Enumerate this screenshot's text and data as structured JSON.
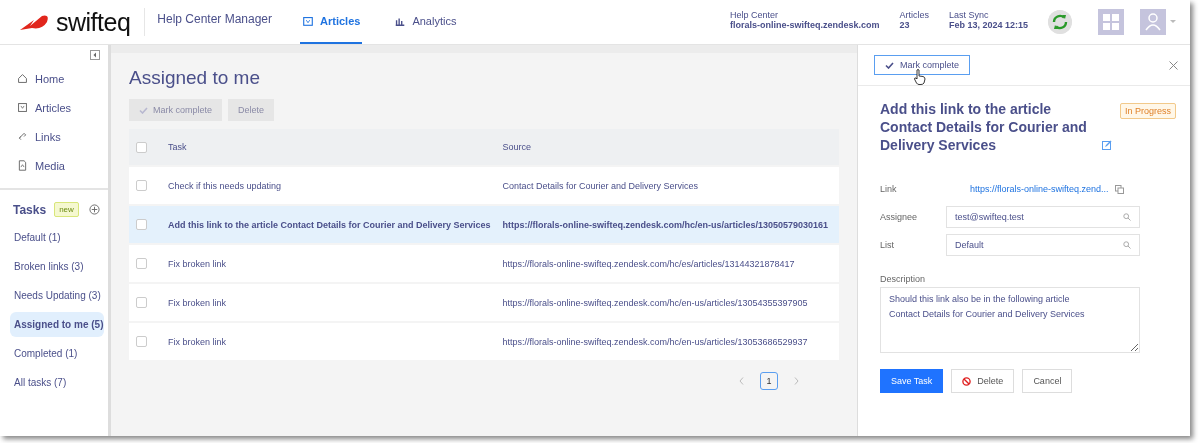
{
  "header": {
    "brand": "swifteq",
    "app_title": "Help Center Manager",
    "tabs": [
      {
        "label": "Articles",
        "selected": true,
        "kind": "articles"
      },
      {
        "label": "Analytics",
        "selected": false,
        "kind": "analytics"
      }
    ],
    "info": [
      {
        "label": "Help Center",
        "value": "florals-online-swifteq.zendesk.com"
      },
      {
        "label": "Articles",
        "value": "23"
      },
      {
        "label": "Last Sync",
        "value": "Feb 13, 2024 12:15"
      }
    ]
  },
  "sidebar": {
    "nav": [
      {
        "label": "Home",
        "kind": "home"
      },
      {
        "label": "Articles",
        "kind": "articles"
      },
      {
        "label": "Links",
        "kind": "links"
      },
      {
        "label": "Media",
        "kind": "media"
      }
    ],
    "tasks_title": "Tasks",
    "tasks_badge": "new",
    "lists": [
      {
        "label": "Default (1)",
        "selected": false
      },
      {
        "label": "Broken links (3)",
        "selected": false
      },
      {
        "label": "Needs Updating (3)",
        "selected": false
      },
      {
        "label": "Assigned to me (5)",
        "selected": true
      },
      {
        "label": "Completed (1)",
        "selected": false
      },
      {
        "label": "All tasks (7)",
        "selected": false
      }
    ]
  },
  "main": {
    "title": "Assigned to me",
    "actions": [
      {
        "label": "Mark complete",
        "disabled": true,
        "kind": "check"
      },
      {
        "label": "Delete",
        "disabled": true,
        "kind": "plain"
      }
    ],
    "table": {
      "columns": [
        "Task",
        "Source"
      ],
      "select_all_checked": false,
      "rows": [
        {
          "task": "Check if this needs updating",
          "source": "Contact Details for Courier and Delivery Services",
          "selected": false,
          "checked": false
        },
        {
          "task": "Add this link to the article Contact Details for Courier and Delivery Services",
          "source": "https://florals-online-swifteq.zendesk.com/hc/en-us/articles/13050579030161",
          "selected": true,
          "checked": false
        },
        {
          "task": "Fix broken link",
          "source": "https://florals-online-swifteq.zendesk.com/hc/es/articles/13144321878417",
          "selected": false,
          "checked": false
        },
        {
          "task": "Fix broken link",
          "source": "https://florals-online-swifteq.zendesk.com/hc/en-us/articles/13054355397905",
          "selected": false,
          "checked": false
        },
        {
          "task": "Fix broken link",
          "source": "https://florals-online-swifteq.zendesk.com/hc/en-us/articles/13053686529937",
          "selected": false,
          "checked": false
        }
      ]
    },
    "pagination": {
      "pages": [
        {
          "label": "1",
          "selected": true
        }
      ]
    }
  },
  "detail": {
    "mark_complete": "Mark complete",
    "title": "Add this link to the article Contact Details for Courier and Delivery Services",
    "status": "In Progress",
    "link_label": "Link",
    "link": "https://florals-online-swifteq.zend...",
    "assignee_label": "Assignee",
    "assignee": "test@swifteq.test",
    "list_label": "List",
    "list": "Default",
    "description_label": "Description",
    "description": "Should this link also be in the following article\nContact Details for Courier and Delivery Services",
    "buttons": [
      {
        "label": "Save Task",
        "kind": "primary"
      },
      {
        "label": "Delete",
        "kind": "danger"
      },
      {
        "label": "Cancel",
        "kind": "plain"
      }
    ]
  }
}
